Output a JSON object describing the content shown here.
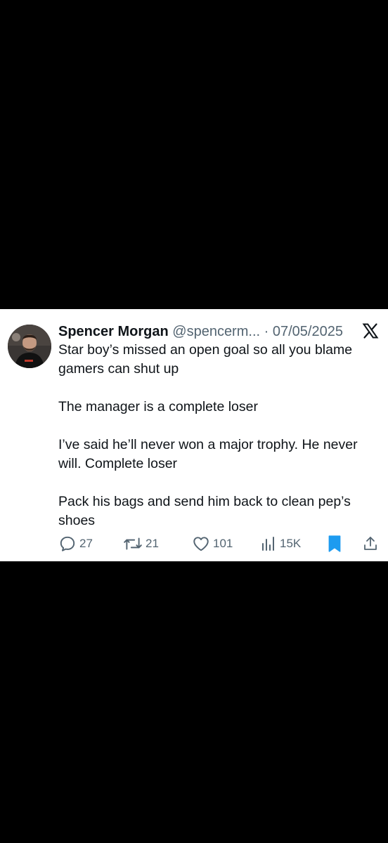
{
  "tweet": {
    "author": {
      "display_name": "Spencer Morgan",
      "handle": "@spencerm...",
      "avatar_icon": "profile-photo"
    },
    "separator": "·",
    "date": "07/05/2025",
    "platform_icon": "x-logo-icon",
    "paragraphs": [
      "Star boy’s missed an open goal so all you blame gamers can shut up",
      "The manager is a complete loser",
      "I’ve said he’ll never won a major trophy. He never will. Complete loser",
      "Pack his bags and send him back to clean pep’s shoes"
    ],
    "stats": {
      "replies": "27",
      "retweets": "21",
      "likes": "101",
      "views": "15K"
    }
  },
  "colors": {
    "background": "#000000",
    "card": "#ffffff",
    "text": "#0f1419",
    "secondary": "#536471",
    "accent": "#1d9bf0"
  }
}
